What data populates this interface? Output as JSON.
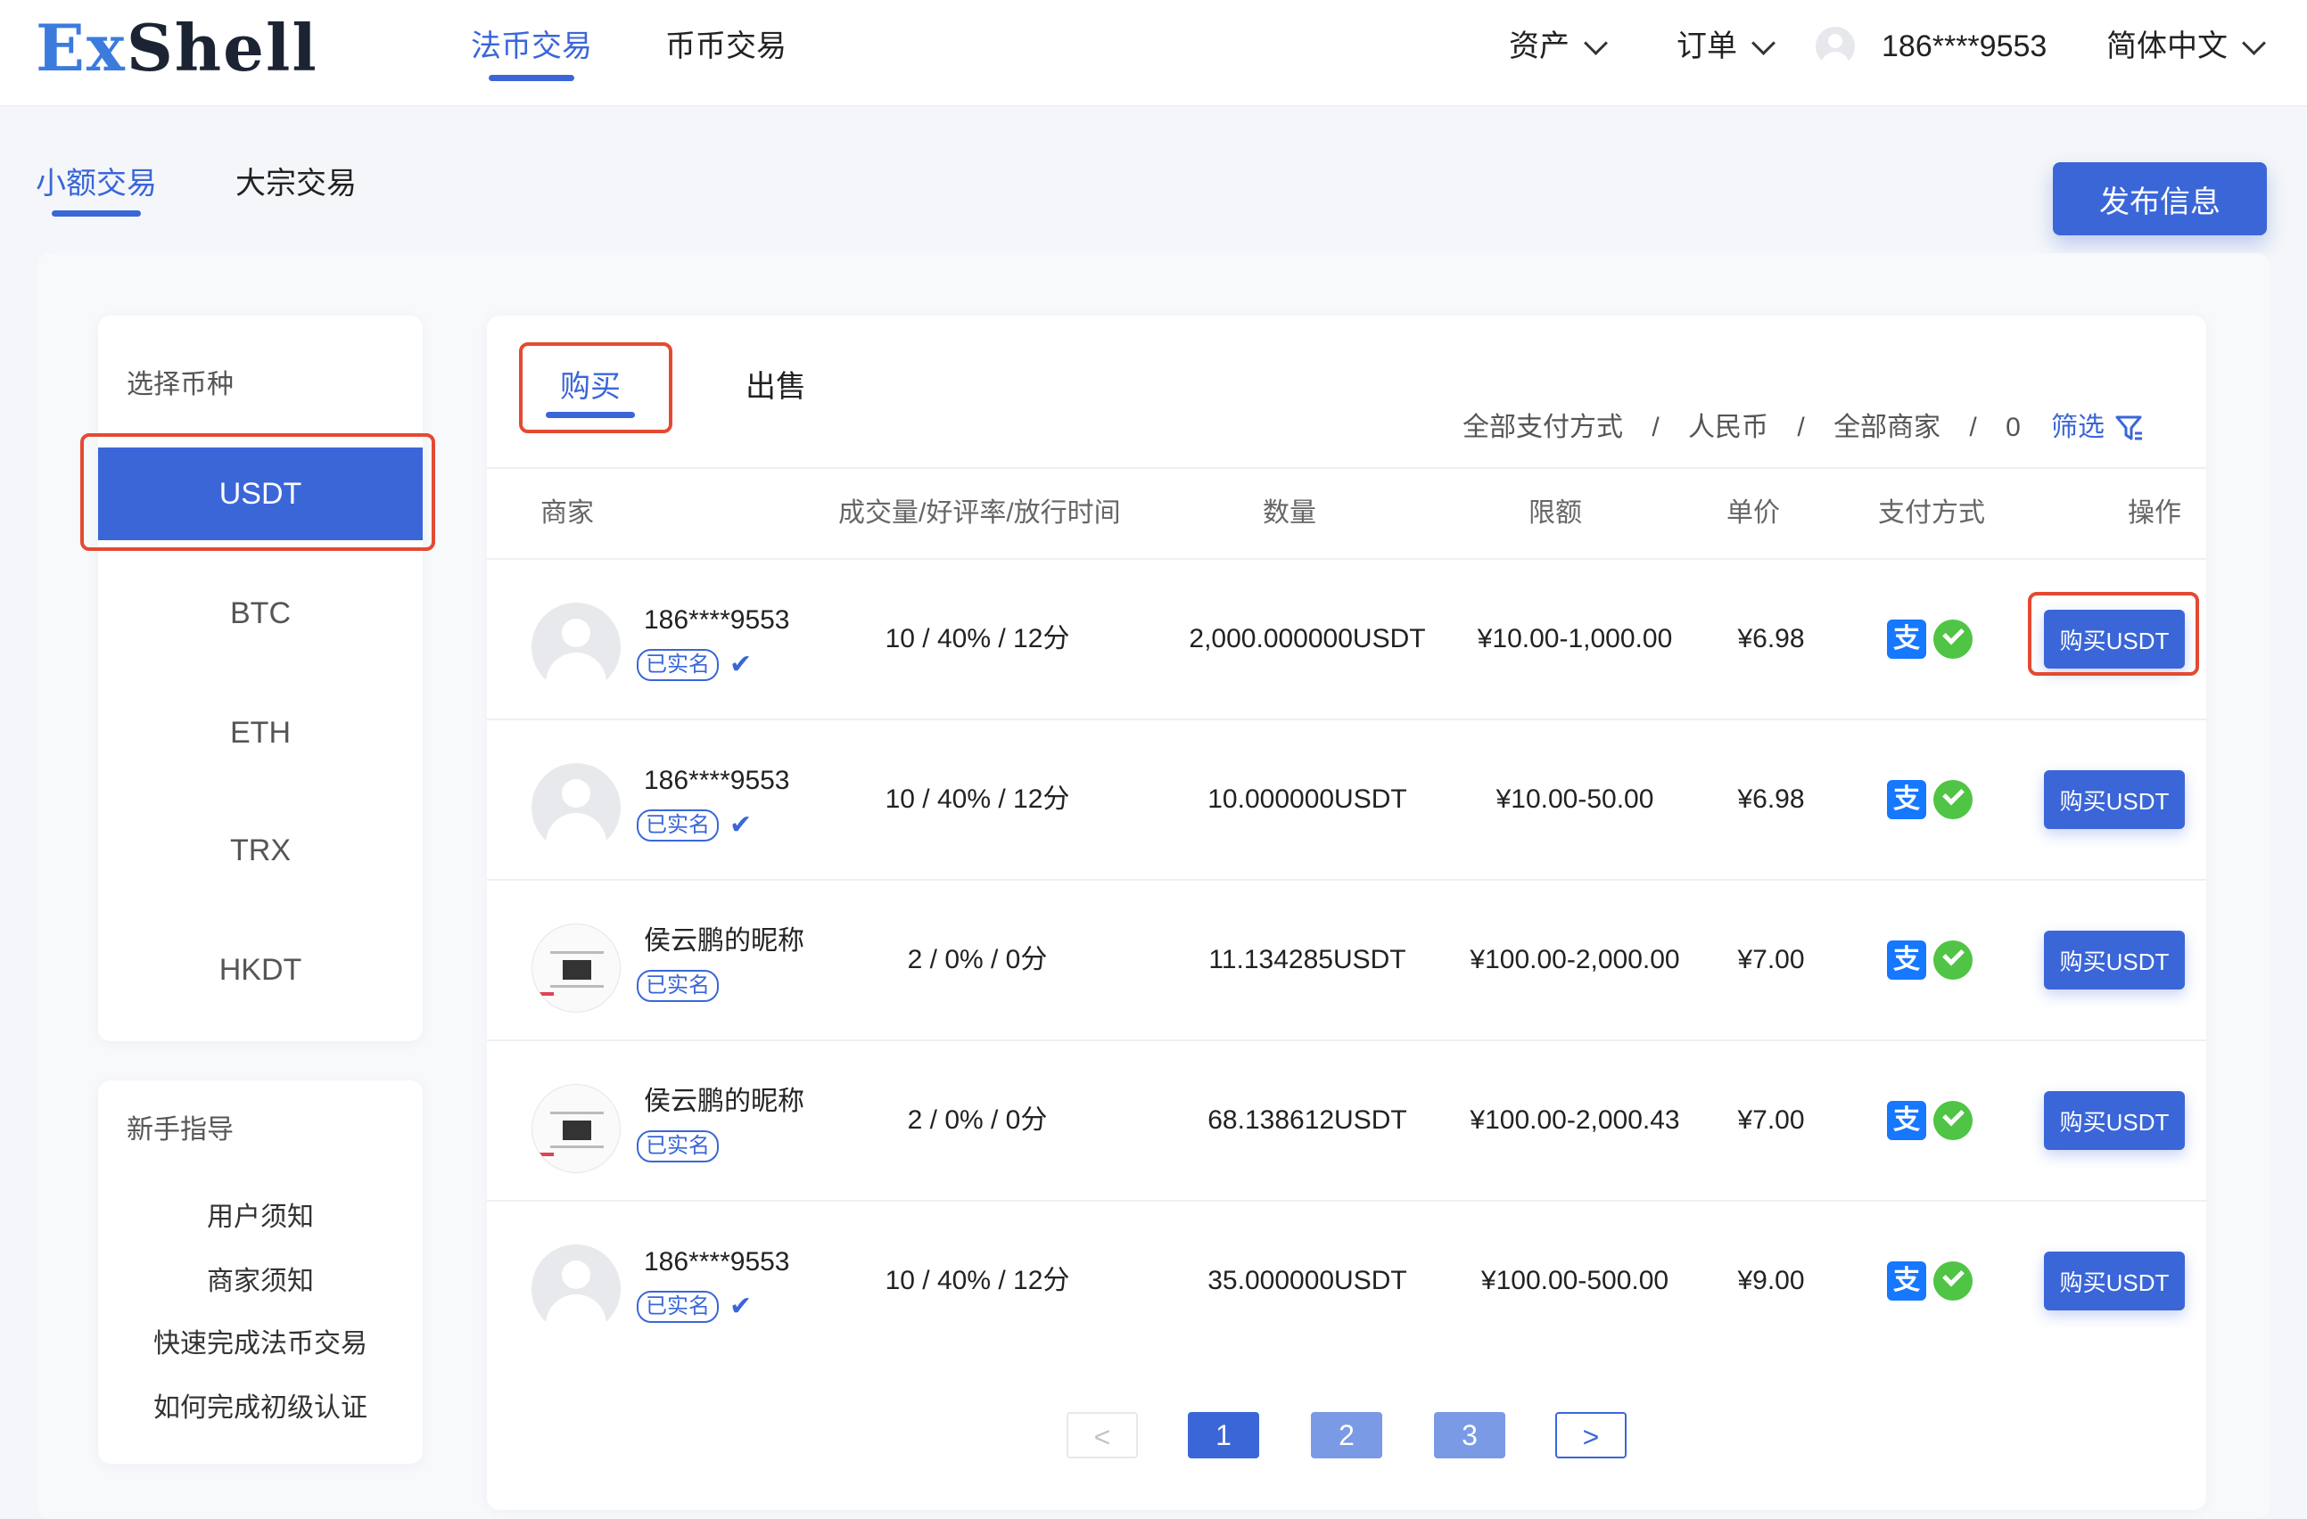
{
  "brand": {
    "logo_part1": "Ex",
    "logo_part2": "Shell"
  },
  "nav": {
    "tabs": [
      "法币交易",
      "币币交易"
    ],
    "assets": "资产",
    "orders": "订单",
    "user_phone": "186****9553",
    "language": "简体中文"
  },
  "subtabs": [
    "小额交易",
    "大宗交易"
  ],
  "publish_button": "发布信息",
  "sidebar": {
    "coin_title": "选择币种",
    "coins": [
      "USDT",
      "BTC",
      "ETH",
      "TRX",
      "HKDT"
    ],
    "guide_title": "新手指导",
    "guides": [
      "用户须知",
      "商家须知",
      "快速完成法币交易",
      "如何完成初级认证"
    ]
  },
  "panel_tabs": [
    "购买",
    "出售"
  ],
  "filters": {
    "payment": "全部支付方式",
    "currency": "人民币",
    "merchant": "全部商家",
    "count": "0",
    "separator": "/",
    "filter_label": "筛选"
  },
  "table": {
    "headers": [
      "商家",
      "成交量/好评率/放行时间",
      "数量",
      "限额",
      "单价",
      "支付方式",
      "操作"
    ],
    "rows": [
      {
        "name": "186****9553",
        "badge": "已实名",
        "verified": "✔",
        "stats": "10 / 40% / 12分",
        "amount": "2,000.000000USDT",
        "limit": "¥10.00-1,000.00",
        "price": "¥6.98",
        "alipay": "支",
        "action": "购买USDT"
      },
      {
        "name": "186****9553",
        "badge": "已实名",
        "verified": "✔",
        "stats": "10 / 40% / 12分",
        "amount": "10.000000USDT",
        "limit": "¥10.00-50.00",
        "price": "¥6.98",
        "alipay": "支",
        "action": "购买USDT"
      },
      {
        "name": "侯云鹏的昵称",
        "badge": "已实名",
        "verified": "",
        "stats": "2 / 0% / 0分",
        "amount": "11.134285USDT",
        "limit": "¥100.00-2,000.00",
        "price": "¥7.00",
        "alipay": "支",
        "action": "购买USDT"
      },
      {
        "name": "侯云鹏的昵称",
        "badge": "已实名",
        "verified": "",
        "stats": "2 / 0% / 0分",
        "amount": "68.138612USDT",
        "limit": "¥100.00-2,000.43",
        "price": "¥7.00",
        "alipay": "支",
        "action": "购买USDT"
      },
      {
        "name": "186****9553",
        "badge": "已实名",
        "verified": "✔",
        "stats": "10 / 40% / 12分",
        "amount": "35.000000USDT",
        "limit": "¥100.00-500.00",
        "price": "¥9.00",
        "alipay": "支",
        "action": "购买USDT"
      }
    ]
  },
  "pagination": {
    "prev": "<",
    "pages": [
      "1",
      "2",
      "3"
    ],
    "current": "1",
    "next": ">"
  },
  "colors": {
    "primary": "#3a66d8",
    "highlight_red": "#e34a32",
    "alipay": "#1677ff",
    "wechat": "#4fc445"
  }
}
